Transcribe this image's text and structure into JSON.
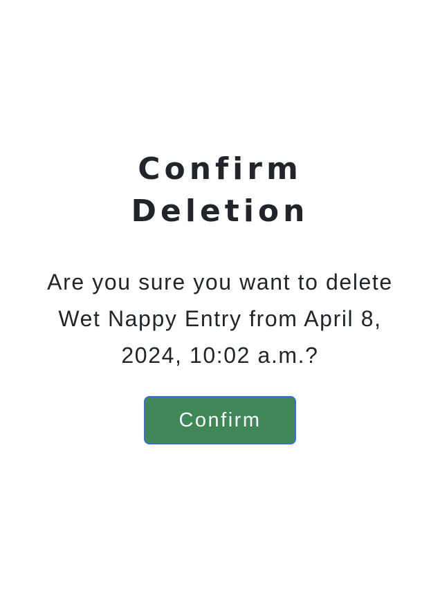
{
  "dialog": {
    "title": "Confirm Deletion",
    "message": "Are you sure you want to delete Wet Nappy Entry from April 8, 2024, 10:02 a.m.?",
    "confirm_label": "Confirm"
  },
  "colors": {
    "text": "#212529",
    "button_bg": "#3f8756",
    "button_border": "#3b6fd6",
    "button_text": "#ffffff",
    "background": "#ffffff"
  }
}
